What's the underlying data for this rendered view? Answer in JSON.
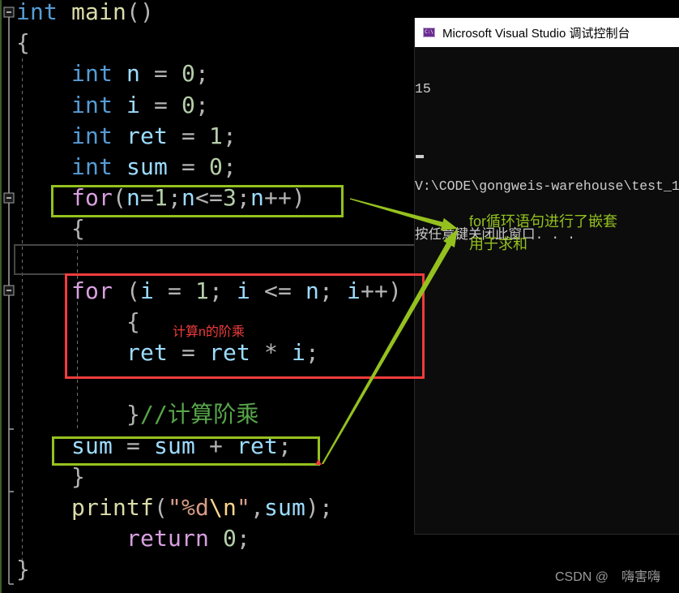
{
  "editor": {
    "theme": {
      "kw": "#569cd6",
      "ctl": "#d8a0df",
      "fn": "#dcdcaa",
      "var": "#9cdcfe",
      "num": "#b5cea8",
      "p": "#b4b4b4",
      "op": "#b4b4b4",
      "str": "#d69d85",
      "esc": "#ffd68f",
      "cmt": "#57a64a"
    },
    "lines": [
      {
        "indent": 0,
        "tokens": [
          [
            "kw",
            "int"
          ],
          [
            "op",
            " "
          ],
          [
            "fn",
            "main"
          ],
          [
            "p",
            "()"
          ]
        ]
      },
      {
        "indent": 0,
        "tokens": [
          [
            "p",
            "{"
          ]
        ]
      },
      {
        "indent": 4,
        "tokens": [
          [
            "kw",
            "int"
          ],
          [
            "op",
            " "
          ],
          [
            "var",
            "n"
          ],
          [
            "op",
            " = "
          ],
          [
            "num",
            "0"
          ],
          [
            "p",
            ";"
          ]
        ]
      },
      {
        "indent": 4,
        "tokens": [
          [
            "kw",
            "int"
          ],
          [
            "op",
            " "
          ],
          [
            "var",
            "i"
          ],
          [
            "op",
            " = "
          ],
          [
            "num",
            "0"
          ],
          [
            "p",
            ";"
          ]
        ]
      },
      {
        "indent": 4,
        "tokens": [
          [
            "kw",
            "int"
          ],
          [
            "op",
            " "
          ],
          [
            "var",
            "ret"
          ],
          [
            "op",
            " = "
          ],
          [
            "num",
            "1"
          ],
          [
            "p",
            ";"
          ]
        ]
      },
      {
        "indent": 4,
        "tokens": [
          [
            "kw",
            "int"
          ],
          [
            "op",
            " "
          ],
          [
            "var",
            "sum"
          ],
          [
            "op",
            " = "
          ],
          [
            "num",
            "0"
          ],
          [
            "p",
            ";"
          ]
        ]
      },
      {
        "indent": 4,
        "tokens": [
          [
            "ctl",
            "for"
          ],
          [
            "p",
            "("
          ],
          [
            "var",
            "n"
          ],
          [
            "op",
            "="
          ],
          [
            "num",
            "1"
          ],
          [
            "p",
            ";"
          ],
          [
            "var",
            "n"
          ],
          [
            "op",
            "<="
          ],
          [
            "num",
            "3"
          ],
          [
            "p",
            ";"
          ],
          [
            "var",
            "n"
          ],
          [
            "op",
            "++"
          ],
          [
            "p",
            ")"
          ]
        ]
      },
      {
        "indent": 4,
        "tokens": [
          [
            "p",
            "{"
          ]
        ]
      },
      {
        "indent": 0,
        "tokens": []
      },
      {
        "indent": 4,
        "tokens": [
          [
            "ctl",
            "for"
          ],
          [
            "p",
            " ("
          ],
          [
            "var",
            "i"
          ],
          [
            "op",
            " = "
          ],
          [
            "num",
            "1"
          ],
          [
            "p",
            "; "
          ],
          [
            "var",
            "i"
          ],
          [
            "op",
            " <= "
          ],
          [
            "var",
            "n"
          ],
          [
            "p",
            "; "
          ],
          [
            "var",
            "i"
          ],
          [
            "op",
            "++"
          ],
          [
            "p",
            ")"
          ]
        ]
      },
      {
        "indent": 8,
        "tokens": [
          [
            "p",
            "{"
          ]
        ]
      },
      {
        "indent": 8,
        "tokens": [
          [
            "var",
            "ret"
          ],
          [
            "op",
            " = "
          ],
          [
            "var",
            "ret"
          ],
          [
            "op",
            " * "
          ],
          [
            "var",
            "i"
          ],
          [
            "p",
            ";"
          ]
        ]
      },
      {
        "indent": 0,
        "tokens": []
      },
      {
        "indent": 8,
        "tokens": [
          [
            "p",
            "}"
          ],
          [
            "cmt",
            "//计算阶乘"
          ]
        ]
      },
      {
        "indent": 4,
        "tokens": [
          [
            "var",
            "sum"
          ],
          [
            "op",
            " = "
          ],
          [
            "var",
            "sum"
          ],
          [
            "op",
            " + "
          ],
          [
            "var",
            "ret"
          ],
          [
            "p",
            ";"
          ]
        ]
      },
      {
        "indent": 4,
        "tokens": [
          [
            "p",
            "}"
          ]
        ]
      },
      {
        "indent": 4,
        "tokens": [
          [
            "fn",
            "printf"
          ],
          [
            "p",
            "("
          ],
          [
            "str",
            "\"%d"
          ],
          [
            "esc",
            "\\n"
          ],
          [
            "str",
            "\""
          ],
          [
            "p",
            ","
          ],
          [
            "var",
            "sum"
          ],
          [
            "p",
            ");"
          ]
        ]
      },
      {
        "indent": 8,
        "tokens": [
          [
            "ctl",
            "return"
          ],
          [
            "op",
            " "
          ],
          [
            "num",
            "0"
          ],
          [
            "p",
            ";"
          ]
        ]
      },
      {
        "indent": 0,
        "tokens": [
          [
            "p",
            "}"
          ]
        ]
      }
    ]
  },
  "console": {
    "title": "Microsoft Visual Studio 调试控制台",
    "icon_glyph": "C:\\",
    "output_lines": [
      "15",
      "",
      "V:\\CODE\\gongweis-warehouse\\test_1",
      "按任意键关闭此窗口. . ."
    ]
  },
  "annotations": {
    "green_color": "#95c11f",
    "red_color": "#f03c3c",
    "nested_loop_note": {
      "line1": "for循环语句进行了嵌套",
      "line2": "用于求和"
    },
    "factorial_note": "计算n的阶乘"
  },
  "watermark": {
    "site": "CSDN @",
    "author": "嗨害嗨"
  }
}
